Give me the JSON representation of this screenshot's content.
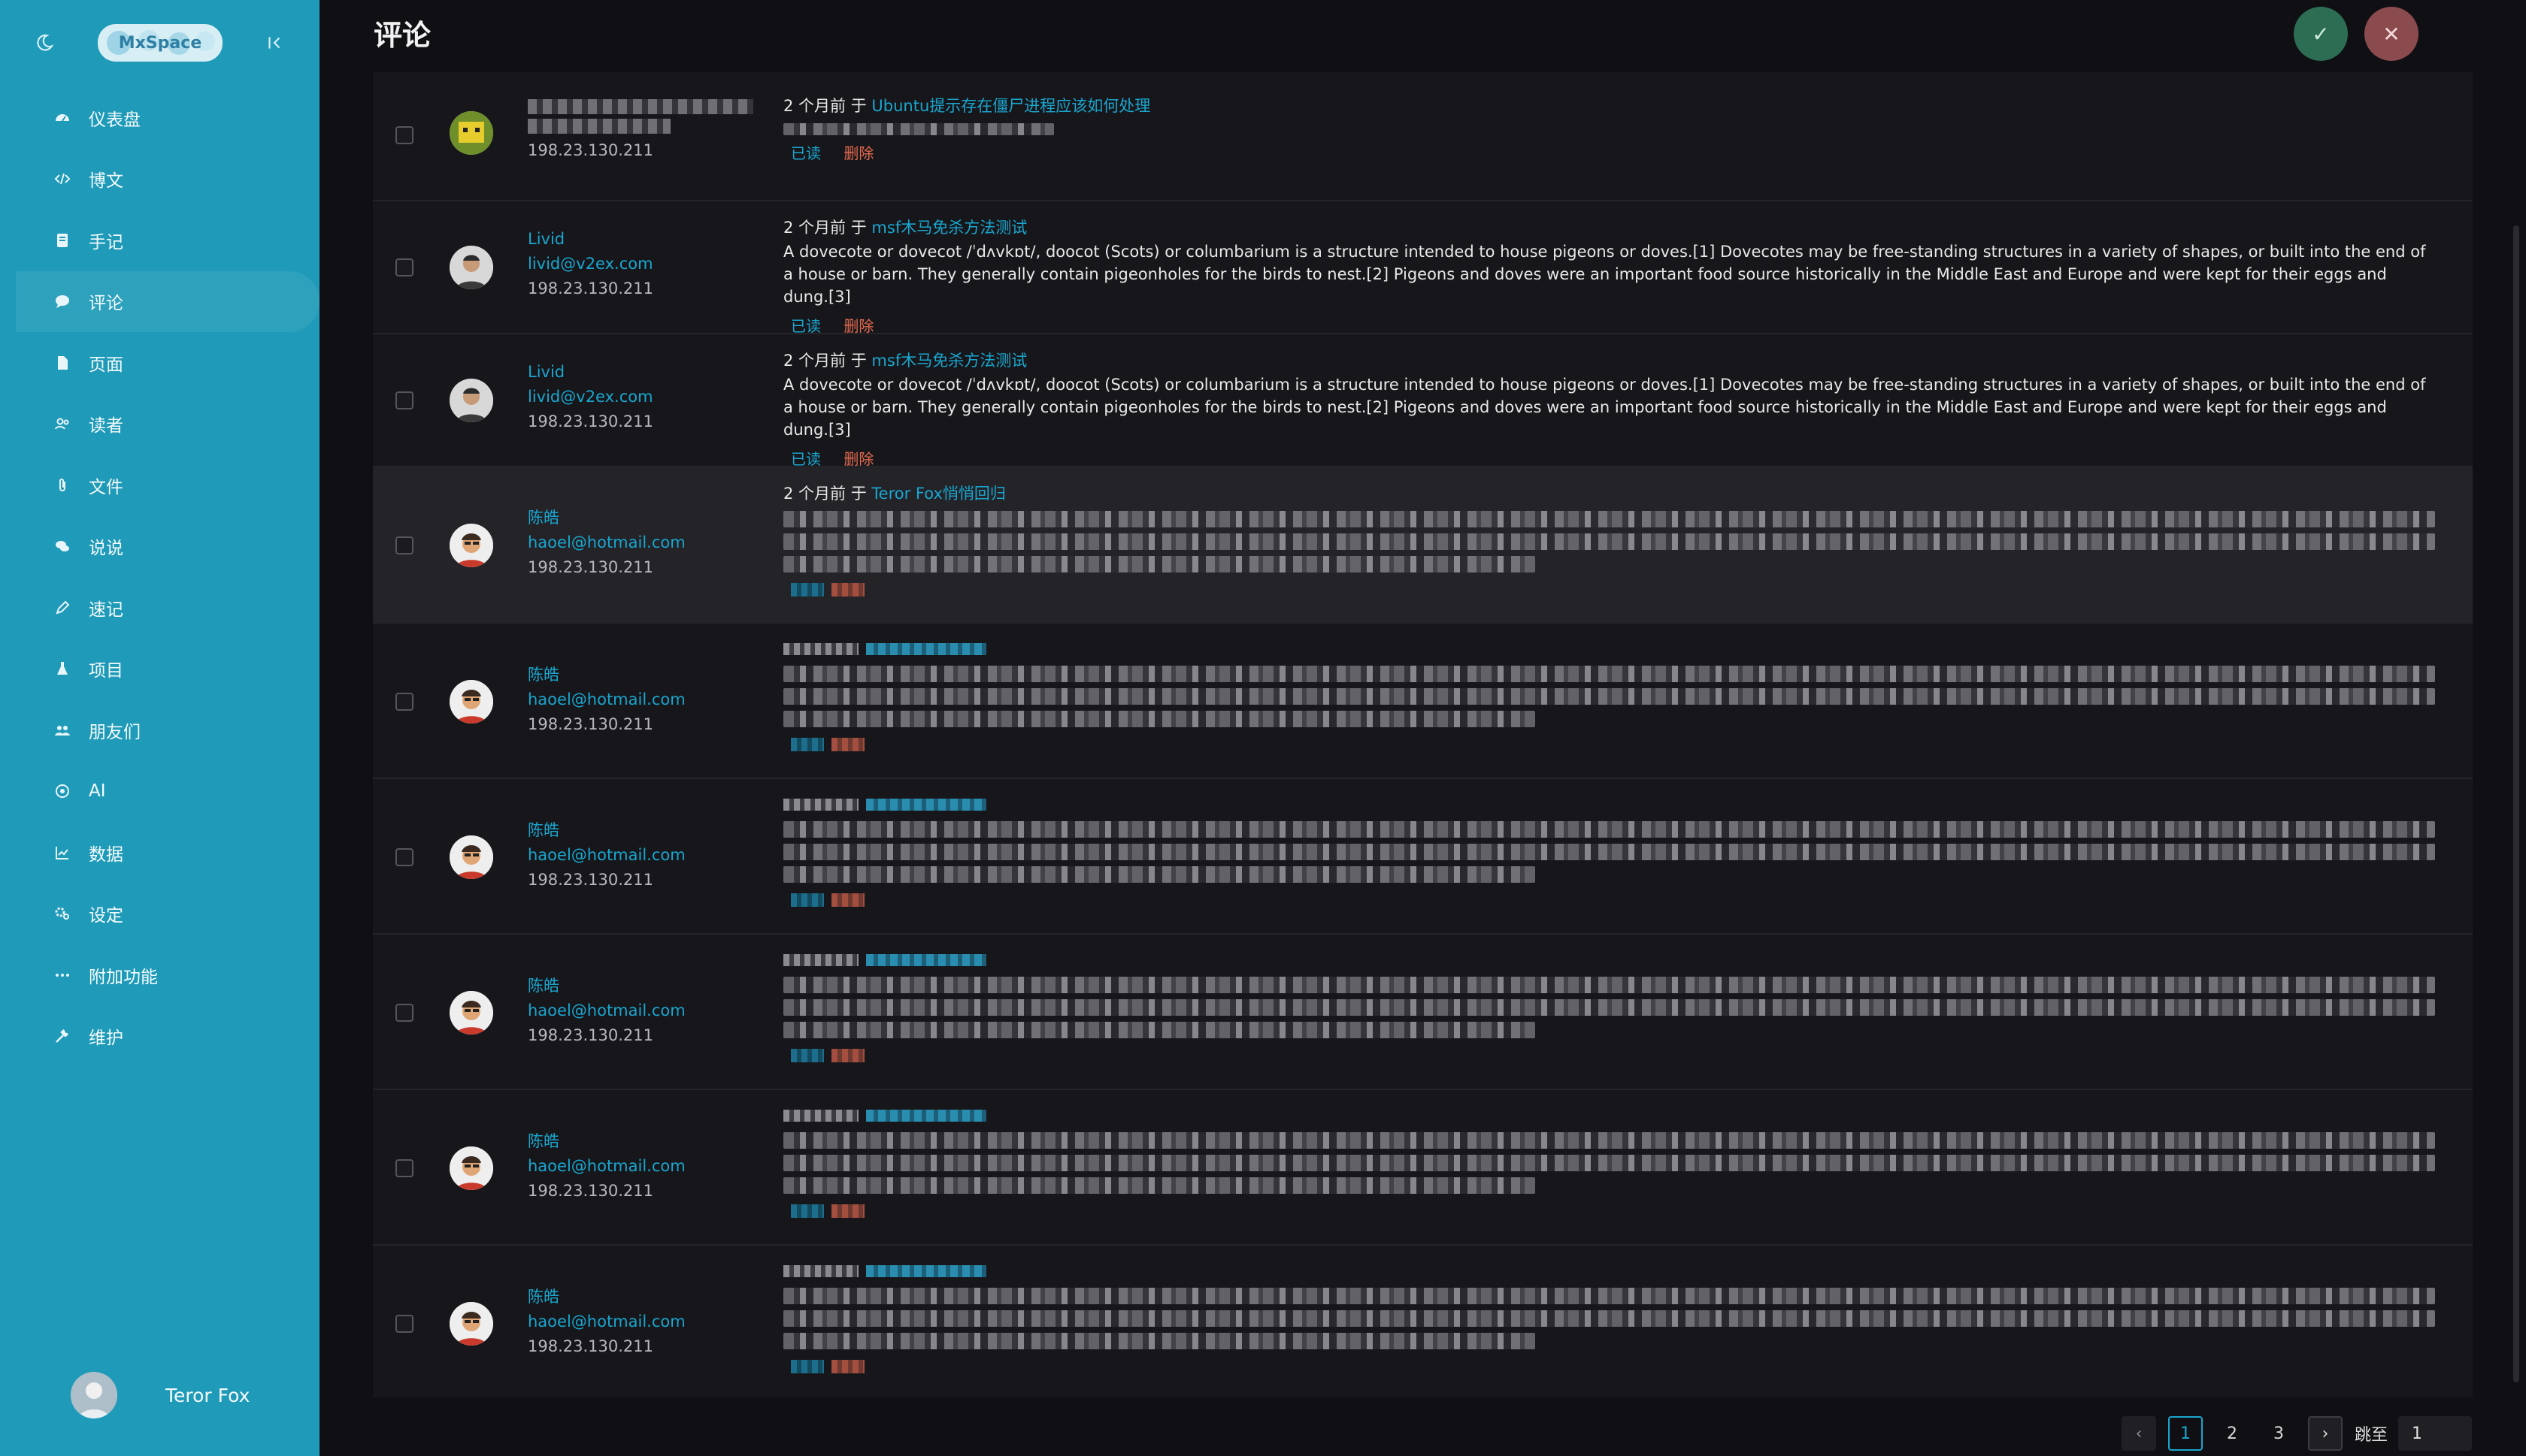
{
  "sidebar": {
    "user": "Teror Fox",
    "items": [
      {
        "label": "仪表盘",
        "icon": "dashboard-icon"
      },
      {
        "label": "博文",
        "icon": "code-icon"
      },
      {
        "label": "手记",
        "icon": "notebook-icon"
      },
      {
        "label": "评论",
        "icon": "comment-icon"
      },
      {
        "label": "页面",
        "icon": "page-icon"
      },
      {
        "label": "读者",
        "icon": "readers-icon"
      },
      {
        "label": "文件",
        "icon": "paperclip-icon"
      },
      {
        "label": "说说",
        "icon": "chat-icon"
      },
      {
        "label": "速记",
        "icon": "pencil-icon"
      },
      {
        "label": "项目",
        "icon": "flask-icon"
      },
      {
        "label": "朋友们",
        "icon": "friends-icon"
      },
      {
        "label": "AI",
        "icon": "ai-icon"
      },
      {
        "label": "数据",
        "icon": "chart-icon"
      },
      {
        "label": "设定",
        "icon": "settings-icon"
      },
      {
        "label": "附加功能",
        "icon": "more-icon"
      },
      {
        "label": "维护",
        "icon": "wrench-icon"
      }
    ]
  },
  "header": {
    "title": "评论"
  },
  "comments": [
    {
      "time": "2 个月前",
      "on": "于",
      "post": "Ubuntu提示存在僵尸进程应该如何处理",
      "ip": "198.23.130.211",
      "read": "已读",
      "delete": "删除"
    },
    {
      "name": "Livid",
      "email": "livid@v2ex.com",
      "ip": "198.23.130.211",
      "time": "2 个月前",
      "on": "于",
      "post": "msf木马免杀方法测试",
      "text": "A dovecote or dovecot /ˈdʌvkɒt/, doocot (Scots) or columbarium is a structure intended to house pigeons or doves.[1] Dovecotes may be free-standing structures in a variety of shapes, or built into the end of a house or barn. They generally contain pigeonholes for the birds to nest.[2] Pigeons and doves were an important food source historically in the Middle East and Europe and were kept for their eggs and dung.[3]",
      "read": "已读",
      "delete": "删除"
    },
    {
      "name": "Livid",
      "email": "livid@v2ex.com",
      "ip": "198.23.130.211",
      "time": "2 个月前",
      "on": "于",
      "post": "msf木马免杀方法测试",
      "text": "A dovecote or dovecot /ˈdʌvkɒt/, doocot (Scots) or columbarium is a structure intended to house pigeons or doves.[1] Dovecotes may be free-standing structures in a variety of shapes, or built into the end of a house or barn. They generally contain pigeonholes for the birds to nest.[2] Pigeons and doves were an important food source historically in the Middle East and Europe and were kept for their eggs and dung.[3]",
      "read": "已读",
      "delete": "删除"
    },
    {
      "name": "陈皓",
      "email": "haoel@hotmail.com",
      "ip": "198.23.130.211",
      "time": "2 个月前",
      "on": "于",
      "post": "Teror Fox悄悄回归"
    },
    {
      "name": "陈皓",
      "email": "haoel@hotmail.com",
      "ip": "198.23.130.211"
    },
    {
      "name": "陈皓",
      "email": "haoel@hotmail.com",
      "ip": "198.23.130.211"
    },
    {
      "name": "陈皓",
      "email": "haoel@hotmail.com",
      "ip": "198.23.130.211"
    },
    {
      "name": "陈皓",
      "email": "haoel@hotmail.com",
      "ip": "198.23.130.211"
    },
    {
      "name": "陈皓",
      "email": "haoel@hotmail.com",
      "ip": "198.23.130.211"
    }
  ],
  "pagination": {
    "pages": [
      "1",
      "2",
      "3"
    ],
    "current": "1",
    "jump_label": "跳至",
    "jump_value": "1"
  },
  "colors": {
    "sidebar": "#1f9ab8",
    "link": "#19a6cf",
    "delete": "#e4694f",
    "approve": "#2c6d54",
    "reject": "#8a4a4e"
  }
}
